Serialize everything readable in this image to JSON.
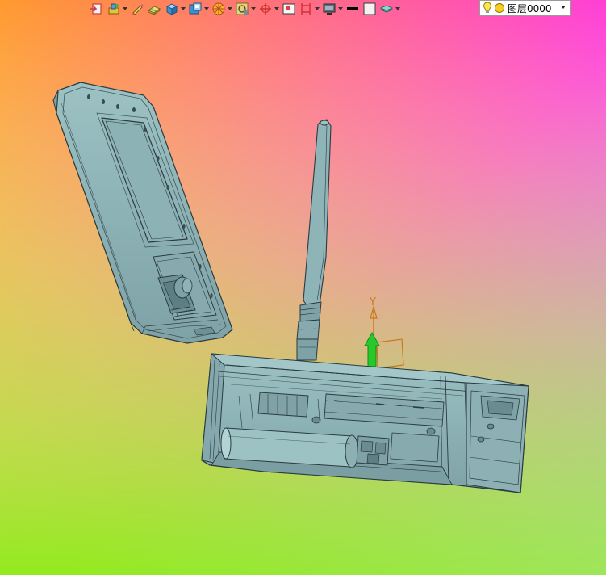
{
  "viewport": {
    "background": {
      "top_left": "#ff9a2e",
      "top_right": "#ff3fd6",
      "bottom_left": "#93ea1e",
      "bottom_right": "#a8e28a",
      "center": "#c9a57a"
    },
    "model_color": "#8fb4b8",
    "edge_color": "#2a3b40",
    "triad": {
      "axis_label": "Y",
      "y_axis_color": "#c8781c",
      "handle_color": "#27c82a"
    }
  },
  "toolbar": {
    "buttons": [
      {
        "icon": "insert-component-icon",
        "has_dropdown": false
      },
      {
        "icon": "assembly-tools-icon",
        "has_dropdown": true
      },
      {
        "icon": "sketch-pen-icon",
        "has_dropdown": false
      },
      {
        "icon": "eraser-icon",
        "has_dropdown": false
      },
      {
        "icon": "solid-cube-icon",
        "has_dropdown": true
      },
      {
        "icon": "view-orientation-icon",
        "has_dropdown": true
      },
      {
        "icon": "render-style-icon",
        "has_dropdown": true
      },
      {
        "icon": "snap-icon",
        "has_dropdown": true
      },
      {
        "icon": "triad-axes-icon",
        "has_dropdown": true
      },
      {
        "icon": "section-view-icon",
        "has_dropdown": false
      },
      {
        "icon": "clipping-plane-icon",
        "has_dropdown": true
      },
      {
        "icon": "display-monitor-icon",
        "has_dropdown": true
      },
      {
        "icon": "line-weight-icon",
        "has_dropdown": false
      },
      {
        "icon": "color-swatch-icon",
        "has_dropdown": false
      },
      {
        "icon": "layer-stack-icon",
        "has_dropdown": true
      }
    ],
    "layer": {
      "lamp_icon": "lightbulb-icon",
      "state_icon": "layer-on-icon",
      "name": "图层0000"
    }
  }
}
